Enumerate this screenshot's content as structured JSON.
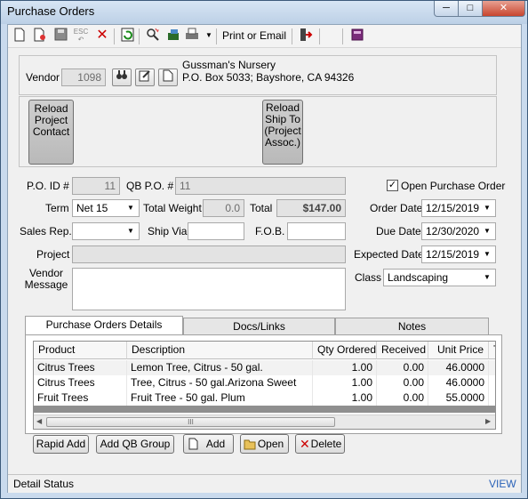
{
  "window": {
    "title": "Purchase Orders"
  },
  "toolbar": {
    "print_email": "Print or Email"
  },
  "vendor": {
    "label": "Vendor",
    "id": "1098",
    "name": "Gussman's Nursery",
    "address": "P.O. Box 5033; Bayshore, CA 94326"
  },
  "reload": {
    "contact": "Reload Project Contact",
    "shipto": "Reload Ship To (Project Assoc.)"
  },
  "form": {
    "po_id_label": "P.O. ID #",
    "po_id": "11",
    "qb_po_label": "QB P.O. #",
    "qb_po": "11",
    "open_po_label": "Open Purchase Order",
    "open_po_checked": "✓",
    "term_label": "Term",
    "term": "Net 15",
    "total_weight_label": "Total Weight",
    "total_weight": "0.0",
    "total_label": "Total",
    "total": "$147.00",
    "order_date_label": "Order Date",
    "order_date": "12/15/2019",
    "sales_rep_label": "Sales Rep.",
    "sales_rep": "",
    "ship_via_label": "Ship Via",
    "ship_via": "",
    "fob_label": "F.O.B.",
    "fob": "",
    "due_date_label": "Due Date",
    "due_date": "12/30/2020",
    "project_label": "Project",
    "project": "",
    "expected_date_label": "Expected Date",
    "expected_date": "12/15/2019",
    "vendor_message_label": "Vendor Message",
    "vendor_message": "",
    "class_label": "Class",
    "class": "Landscaping"
  },
  "tabs": [
    {
      "label": "Purchase Orders Details"
    },
    {
      "label": "Docs/Links"
    },
    {
      "label": "Notes"
    }
  ],
  "grid": {
    "columns": [
      "Product",
      "Description",
      "Qty Ordered",
      "Received",
      "Unit Price",
      "T"
    ],
    "rows": [
      {
        "product": "Citrus Trees",
        "description": "Lemon Tree, Citrus - 50 gal.",
        "qty": "1.00",
        "received": "0.00",
        "unit_price": "46.0000"
      },
      {
        "product": "Citrus Trees",
        "description": "Tree, Citrus - 50 gal.Arizona Sweet",
        "qty": "1.00",
        "received": "0.00",
        "unit_price": "46.0000"
      },
      {
        "product": "Fruit Trees",
        "description": "Fruit Tree - 50 gal. Plum",
        "qty": "1.00",
        "received": "0.00",
        "unit_price": "55.0000"
      }
    ],
    "scroll_grip": "III"
  },
  "buttons": {
    "rapid_add": "Rapid Add",
    "add_qb_group": "Add QB Group",
    "add": "Add",
    "open": "Open",
    "delete": "Delete"
  },
  "status": {
    "text": "Detail Status",
    "view": "VIEW"
  },
  "icons": {
    "new": "new-doc-icon",
    "copy": "copy-doc-icon",
    "save": "save-icon",
    "esc": "undo-icon",
    "delete": "delete-icon",
    "refresh": "refresh-icon",
    "search": "search-icon",
    "tools": "tools-icon",
    "print": "print-icon",
    "exit": "exit-icon",
    "book": "book-icon"
  }
}
